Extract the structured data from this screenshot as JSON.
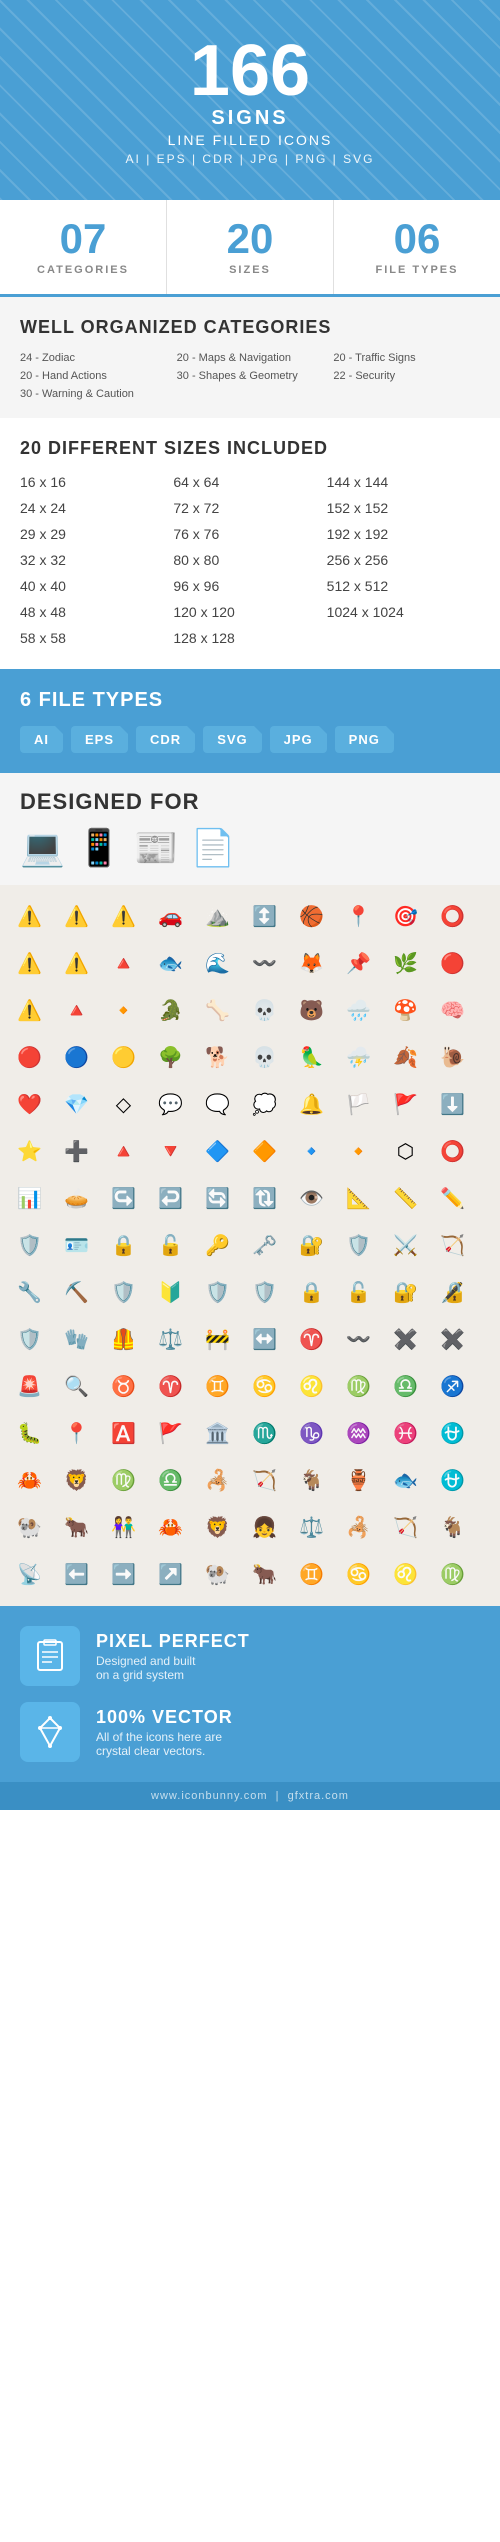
{
  "hero": {
    "number": "166",
    "title": "SIGNS",
    "subtitle": "LINE FILLED ICONS",
    "formats": "AI  |  EPS  |  CDR  |  JPG  |  PNG  |  SVG"
  },
  "stats": [
    {
      "id": "categories",
      "number": "07",
      "label": "CATEGORIES"
    },
    {
      "id": "sizes",
      "number": "20",
      "label": "SIZES"
    },
    {
      "id": "filetypes",
      "number": "06",
      "label": "FILE TYPES"
    }
  ],
  "organized_section": {
    "title": "WELL ORGANIZED CATEGORIES",
    "categories": [
      "24 - Zodiac",
      "20 - Hand Actions",
      "30 - Warning & Caution",
      "20 - Maps & Navigation",
      "30 - Shapes & Geometry",
      "",
      "20 - Traffic Signs",
      "22 - Security",
      ""
    ]
  },
  "sizes_section": {
    "title": "20 DIFFERENT SIZES INCLUDED",
    "sizes": [
      "16 x 16",
      "64 x 64",
      "144 x 144",
      "24 x 24",
      "72 x 72",
      "152 x 152",
      "29 x 29",
      "76 x 76",
      "192 x 192",
      "32 x 32",
      "80 x 80",
      "256 x 256",
      "40 x 40",
      "96 x 96",
      "512 x 512",
      "48 x 48",
      "120 x 120",
      "1024 x 1024",
      "58 x 58",
      "128 x 128",
      ""
    ]
  },
  "filetypes_section": {
    "title": "6 FILE TYPES",
    "types": [
      "AI",
      "EPS",
      "CDR",
      "SVG",
      "JPG",
      "PNG"
    ]
  },
  "designed_section": {
    "title": "DESIGNED FOR"
  },
  "features": [
    {
      "id": "pixel-perfect",
      "title": "PIXEL PERFECT",
      "description": "Designed and built\non a grid system",
      "icon": "📋"
    },
    {
      "id": "vector",
      "title": "100% VECTOR",
      "description": "All of the icons here are\ncrystal clear vectors.",
      "icon": "✏️"
    }
  ],
  "footer": {
    "url": "www.iconbunny.com",
    "watermark": "gfxtra.com"
  },
  "colors": {
    "primary": "#4a9fd4",
    "light_bg": "#f5f5f5",
    "icon_bg": "#f0ede8"
  }
}
